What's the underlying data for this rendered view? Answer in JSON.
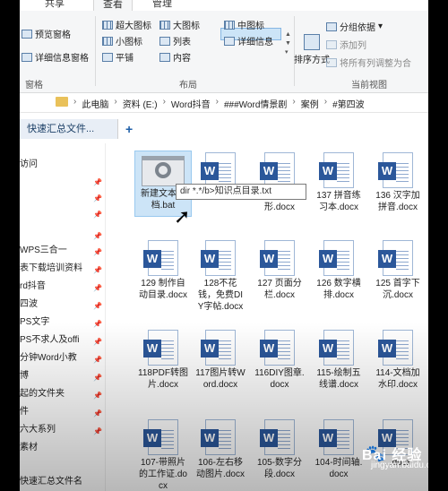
{
  "ribbon": {
    "tabs": [
      "共享",
      "查看",
      "管理"
    ],
    "active_tab": "查看",
    "pane_buttons": {
      "preview": "预览窗格",
      "details": "详细信息窗格",
      "panes_group": "窗格"
    },
    "layout_options": [
      "超大图标",
      "大图标",
      "中图标",
      "小图标",
      "列表",
      "详细信息",
      "平铺",
      "内容"
    ],
    "selected_layout": "中图标",
    "layout_group": "布局",
    "sort_by": "排序方式",
    "group_by": "分组依据",
    "add_column": "添加列",
    "fit_columns": "将所有列调整为合",
    "current_view_group": "当前视图"
  },
  "address": {
    "crumbs": [
      "此电脑",
      "资料 (E:)",
      "Word抖音",
      "###Word情景剧",
      "案例",
      "#第四波"
    ],
    "separator": "›"
  },
  "quick_access_tab": {
    "label": "快速汇总文件...",
    "plus": "+"
  },
  "nav": {
    "items": [
      {
        "label": "访问",
        "pinned": false
      },
      {
        "label": "",
        "pinned": true
      },
      {
        "label": "",
        "pinned": true
      },
      {
        "label": "",
        "pinned": true
      },
      {
        "label": "",
        "pinned": true
      },
      {
        "label": "WPS三合一",
        "pinned": true
      },
      {
        "label": "表下载培训资料",
        "pinned": true
      },
      {
        "label": "rd抖音",
        "pinned": true
      },
      {
        "label": "四波",
        "pinned": true
      },
      {
        "label": "PS文字",
        "pinned": true
      },
      {
        "label": "PS不求人及offi",
        "pinned": true
      },
      {
        "label": "分钟Word小教",
        "pinned": true
      },
      {
        "label": "博",
        "pinned": true
      },
      {
        "label": "起的文件夹",
        "pinned": true
      },
      {
        "label": "件",
        "pinned": true
      },
      {
        "label": "六大系列",
        "pinned": true
      },
      {
        "label": "素材",
        "pinned": false
      },
      {
        "label": "",
        "pinned": false
      },
      {
        "label": "快速汇总文件名",
        "pinned": false
      }
    ]
  },
  "files": [
    {
      "name": "新建文本文档.bat",
      "type": "bat",
      "selected": true
    },
    {
      "name": "...配.docx",
      "type": "docx"
    },
    {
      "name": "...图表不变形.docx",
      "type": "docx"
    },
    {
      "name": "137 拼音练习本.docx",
      "type": "docx"
    },
    {
      "name": "136 汉字加拼音.docx",
      "type": "docx"
    },
    {
      "name": "129 制作自动目录.docx",
      "type": "docx"
    },
    {
      "name": "128不花钱，免费DIY字帖.docx",
      "type": "docx"
    },
    {
      "name": "127 页面分栏.docx",
      "type": "docx"
    },
    {
      "name": "126 数字横排.docx",
      "type": "docx"
    },
    {
      "name": "125 首字下沉.docx",
      "type": "docx"
    },
    {
      "name": "118PDF转图片.docx",
      "type": "docx"
    },
    {
      "name": "117图片转Word.docx",
      "type": "docx"
    },
    {
      "name": "116DIY图章.docx",
      "type": "docx"
    },
    {
      "name": "115-绘制五线谱.docx",
      "type": "docx"
    },
    {
      "name": "114-文档加水印.docx",
      "type": "docx"
    },
    {
      "name": "107-带照片的工作证.docx",
      "type": "docx"
    },
    {
      "name": "106-左右移动图片.docx",
      "type": "docx"
    },
    {
      "name": "105-数字分段.docx",
      "type": "docx"
    },
    {
      "name": "104-时间轴.docx",
      "type": "docx"
    },
    {
      "name": "...docx",
      "type": "docx"
    }
  ],
  "tooltip": "dir *.*/b>知识点目录.txt",
  "watermark": {
    "main": "Bai 经验",
    "sub": "jingyan.baidu.com"
  }
}
